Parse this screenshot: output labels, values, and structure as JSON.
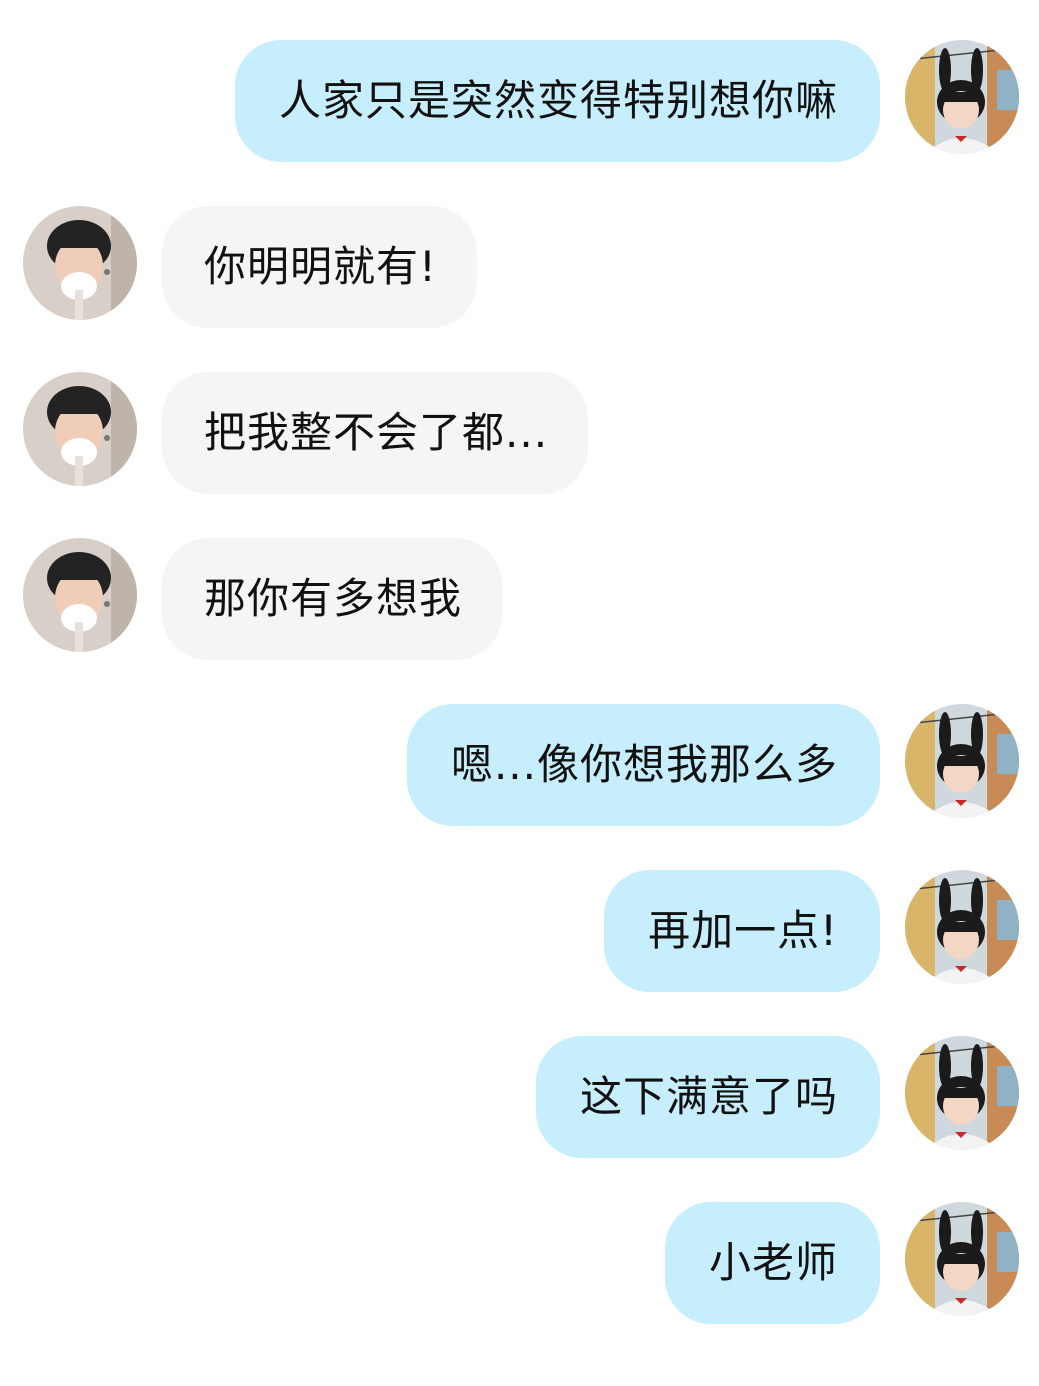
{
  "conversation": {
    "messages": [
      {
        "side": "right",
        "sender": "her",
        "text": "人家只是突然变得特别想你嘛"
      },
      {
        "side": "left",
        "sender": "him",
        "text": "你明明就有!"
      },
      {
        "side": "left",
        "sender": "him",
        "text": "把我整不会了都..."
      },
      {
        "side": "left",
        "sender": "him",
        "text": "那你有多想我"
      },
      {
        "side": "right",
        "sender": "her",
        "text": "嗯...像你想我那么多"
      },
      {
        "side": "right",
        "sender": "her",
        "text": "再加一点!"
      },
      {
        "side": "right",
        "sender": "her",
        "text": "这下满意了吗"
      },
      {
        "side": "right",
        "sender": "her",
        "text": "小老师"
      }
    ]
  },
  "colors": {
    "sent_bubble": "#c6eefc",
    "received_bubble": "#f4f5f7",
    "text": "#111111",
    "background": "#ffffff"
  },
  "icons": {
    "her_avatar": "girl-avatar",
    "his_avatar": "boy-avatar"
  }
}
